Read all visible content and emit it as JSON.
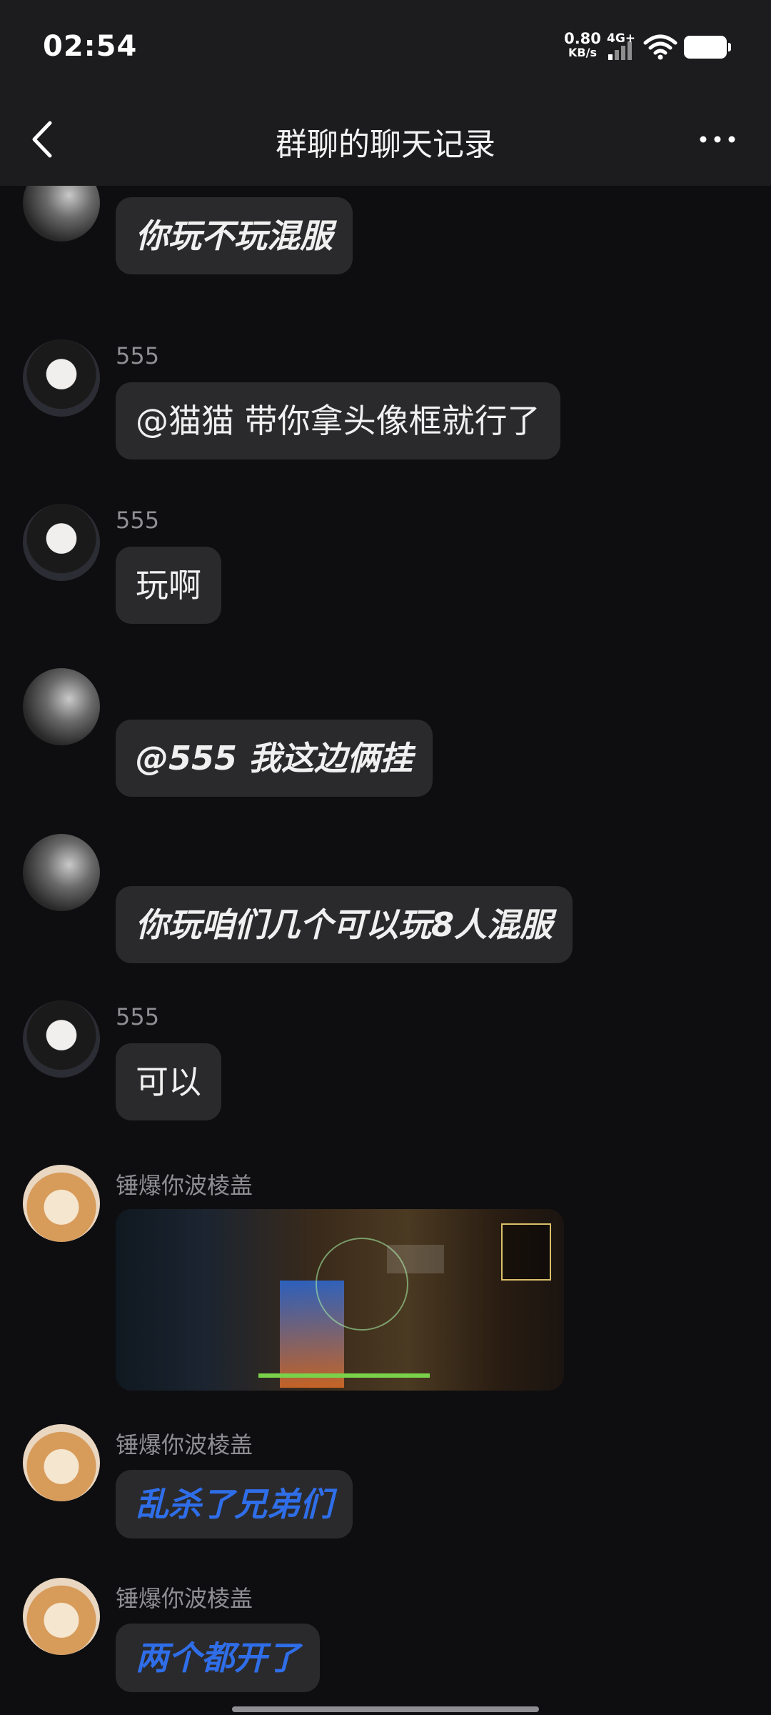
{
  "status_bar": {
    "time": "02:54",
    "net_speed": "0.80",
    "net_unit": "KB/s",
    "network_type": "4G+",
    "icons": [
      "signal-icon",
      "wifi-icon",
      "battery-icon"
    ]
  },
  "nav": {
    "title": "群聊的聊天记录",
    "back_icon": "chevron-left-icon",
    "more_icon": "more-dots-icon"
  },
  "messages": [
    {
      "sender": "",
      "avatar": "grayscale-person-avatar",
      "text": "你玩不玩混服",
      "style": "italic-bold"
    },
    {
      "sender": "555",
      "avatar": "anime-girl-avatar",
      "text": "@猫猫 带你拿头像框就行了",
      "style": "normal"
    },
    {
      "sender": "555",
      "avatar": "anime-girl-avatar",
      "text": "玩啊",
      "style": "normal"
    },
    {
      "sender": "",
      "avatar": "grayscale-person-avatar",
      "text": "@555 我这边俩挂",
      "style": "italic-bold"
    },
    {
      "sender": "",
      "avatar": "grayscale-person-avatar",
      "text": "你玩咱们几个可以玩8人混服",
      "style": "italic-bold"
    },
    {
      "sender": "555",
      "avatar": "anime-girl-avatar",
      "text": "可以",
      "style": "normal"
    },
    {
      "sender": "锤爆你波棱盖",
      "avatar": "shiba-dog-avatar",
      "image": "game-screenshot"
    },
    {
      "sender": "锤爆你波棱盖",
      "avatar": "shiba-dog-avatar",
      "text": "乱杀了兄弟们",
      "style": "blue-italic"
    },
    {
      "sender": "锤爆你波棱盖",
      "avatar": "shiba-dog-avatar",
      "text": "两个都开了",
      "style": "blue-italic"
    }
  ],
  "colors": {
    "background": "#0e0e10",
    "header": "#1c1c1e",
    "bubble": "#2a2a2d",
    "sender_name": "#8e8e93",
    "blue_text": "#2f6ee8"
  }
}
